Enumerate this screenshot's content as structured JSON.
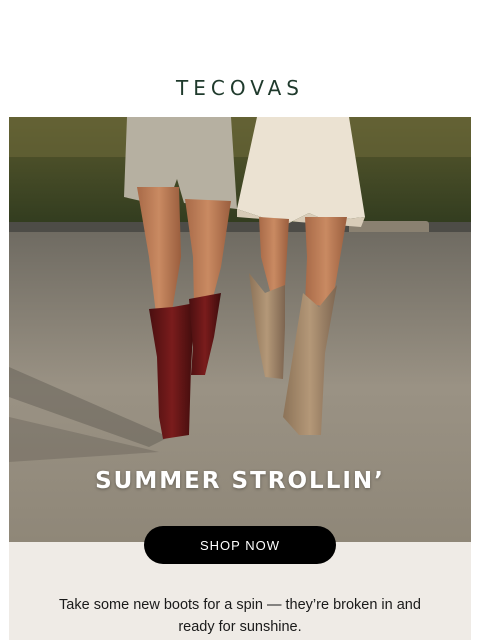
{
  "brand": {
    "logo_text": "TECOVAS"
  },
  "hero": {
    "title": "SUMMER STROLLIN’",
    "image_description_icon": "photo-two-people-walking-in-cowboy-boots"
  },
  "cta": {
    "label": "SHOP NOW"
  },
  "body": {
    "copy": "Take some new boots for a spin — they’re broken in and ready for sunshine."
  },
  "colors": {
    "logo": "#1f3a2c",
    "cta_bg": "#000000",
    "cta_text": "#ffffff",
    "bottom_bg": "#efebe6"
  }
}
